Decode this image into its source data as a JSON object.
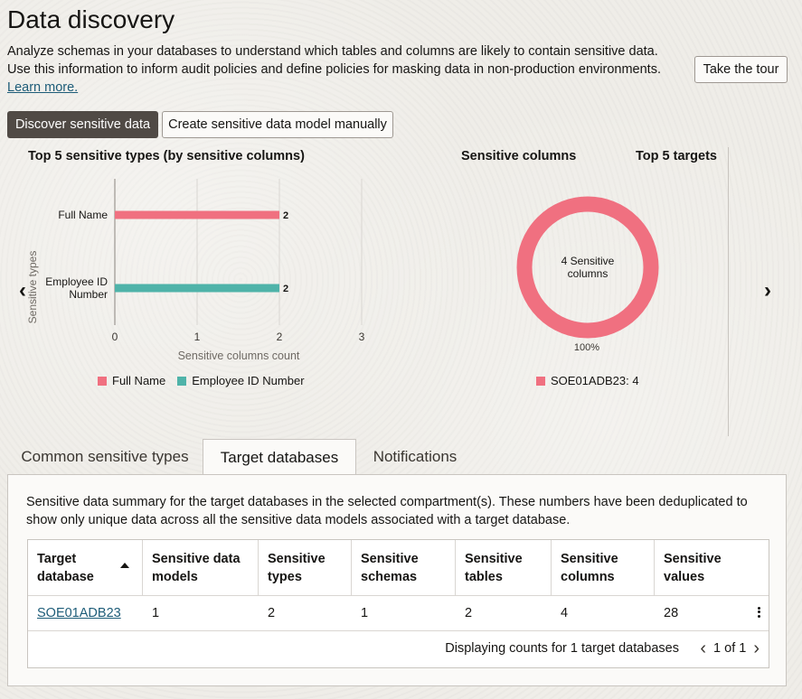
{
  "page": {
    "title": "Data discovery",
    "intro": "Analyze schemas in your databases to understand which tables and columns are likely to contain sensitive data. Use this information to inform audit policies and define policies for masking data in non-production environments.",
    "learn_more": "Learn more.",
    "tour_button": "Take the tour"
  },
  "actions": {
    "discover": "Discover sensitive data",
    "create_manual": "Create sensitive data model manually"
  },
  "carousel": {
    "prev": "‹",
    "next": "›",
    "tab_labels": [
      "Sensitive columns",
      "Top 5 targets"
    ]
  },
  "chart_data": [
    {
      "type": "bar",
      "orientation": "horizontal",
      "title": "Top 5 sensitive types (by sensitive columns)",
      "categories": [
        "Full Name",
        "Employee ID Number"
      ],
      "values": [
        2,
        2
      ],
      "data_labels": [
        "2",
        "2"
      ],
      "colors": [
        "#f07080",
        "#4fb3a9"
      ],
      "xlabel": "Sensitive columns count",
      "ylabel": "Sensitive types",
      "xlim": [
        0,
        3
      ],
      "xticks": [
        "0",
        "1",
        "2",
        "3"
      ],
      "grid": true,
      "legend": [
        "Full Name",
        "Employee ID Number"
      ],
      "legend_position": "bottom"
    },
    {
      "type": "pie",
      "variant": "donut",
      "center_label": "4 Sensitive columns",
      "slices": [
        {
          "name": "SOE01ADB23",
          "value": 4,
          "percent_label": "100%"
        }
      ],
      "legend": [
        "SOE01ADB23: 4"
      ],
      "colors": [
        "#f07080"
      ],
      "legend_position": "bottom"
    }
  ],
  "tabs": [
    {
      "label": "Common sensitive types",
      "active": false
    },
    {
      "label": "Target databases",
      "active": true
    },
    {
      "label": "Notifications",
      "active": false
    }
  ],
  "panel": {
    "description": "Sensitive data summary for the target databases in the selected compartment(s). These numbers have been deduplicated to show only unique data across all the sensitive data models associated with a target database."
  },
  "table": {
    "headers": [
      "Target database",
      "Sensitive data models",
      "Sensitive types",
      "Sensitive schemas",
      "Sensitive tables",
      "Sensitive columns",
      "Sensitive values"
    ],
    "rows": [
      [
        "SOE01ADB23",
        "1",
        "2",
        "1",
        "2",
        "4",
        "28"
      ]
    ],
    "footer": "Displaying counts for 1 target databases",
    "pager": "1 of 1"
  },
  "colors": {
    "primary_button": "#504a45",
    "link": "#1d5c78",
    "bar_full_name": "#f07080",
    "bar_employee_id": "#4fb3a9"
  }
}
